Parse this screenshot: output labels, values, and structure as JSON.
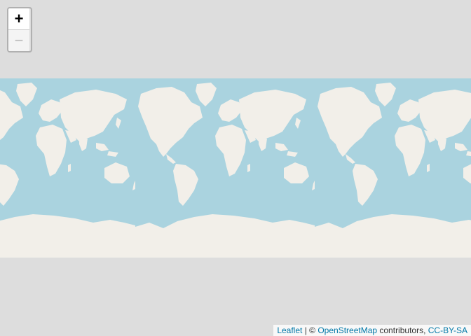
{
  "map": {
    "zoom_in_label": "+",
    "zoom_out_label": "−",
    "attribution": {
      "leaflet": "Leaflet",
      "sep": " | © ",
      "osm": "OpenStreetMap",
      "contributors": " contributors, ",
      "license": "CC-BY-SA"
    },
    "colors": {
      "ocean": "#aad3df",
      "land": "#f2efe9",
      "background": "#dddddd",
      "link": "#0078a8"
    }
  }
}
